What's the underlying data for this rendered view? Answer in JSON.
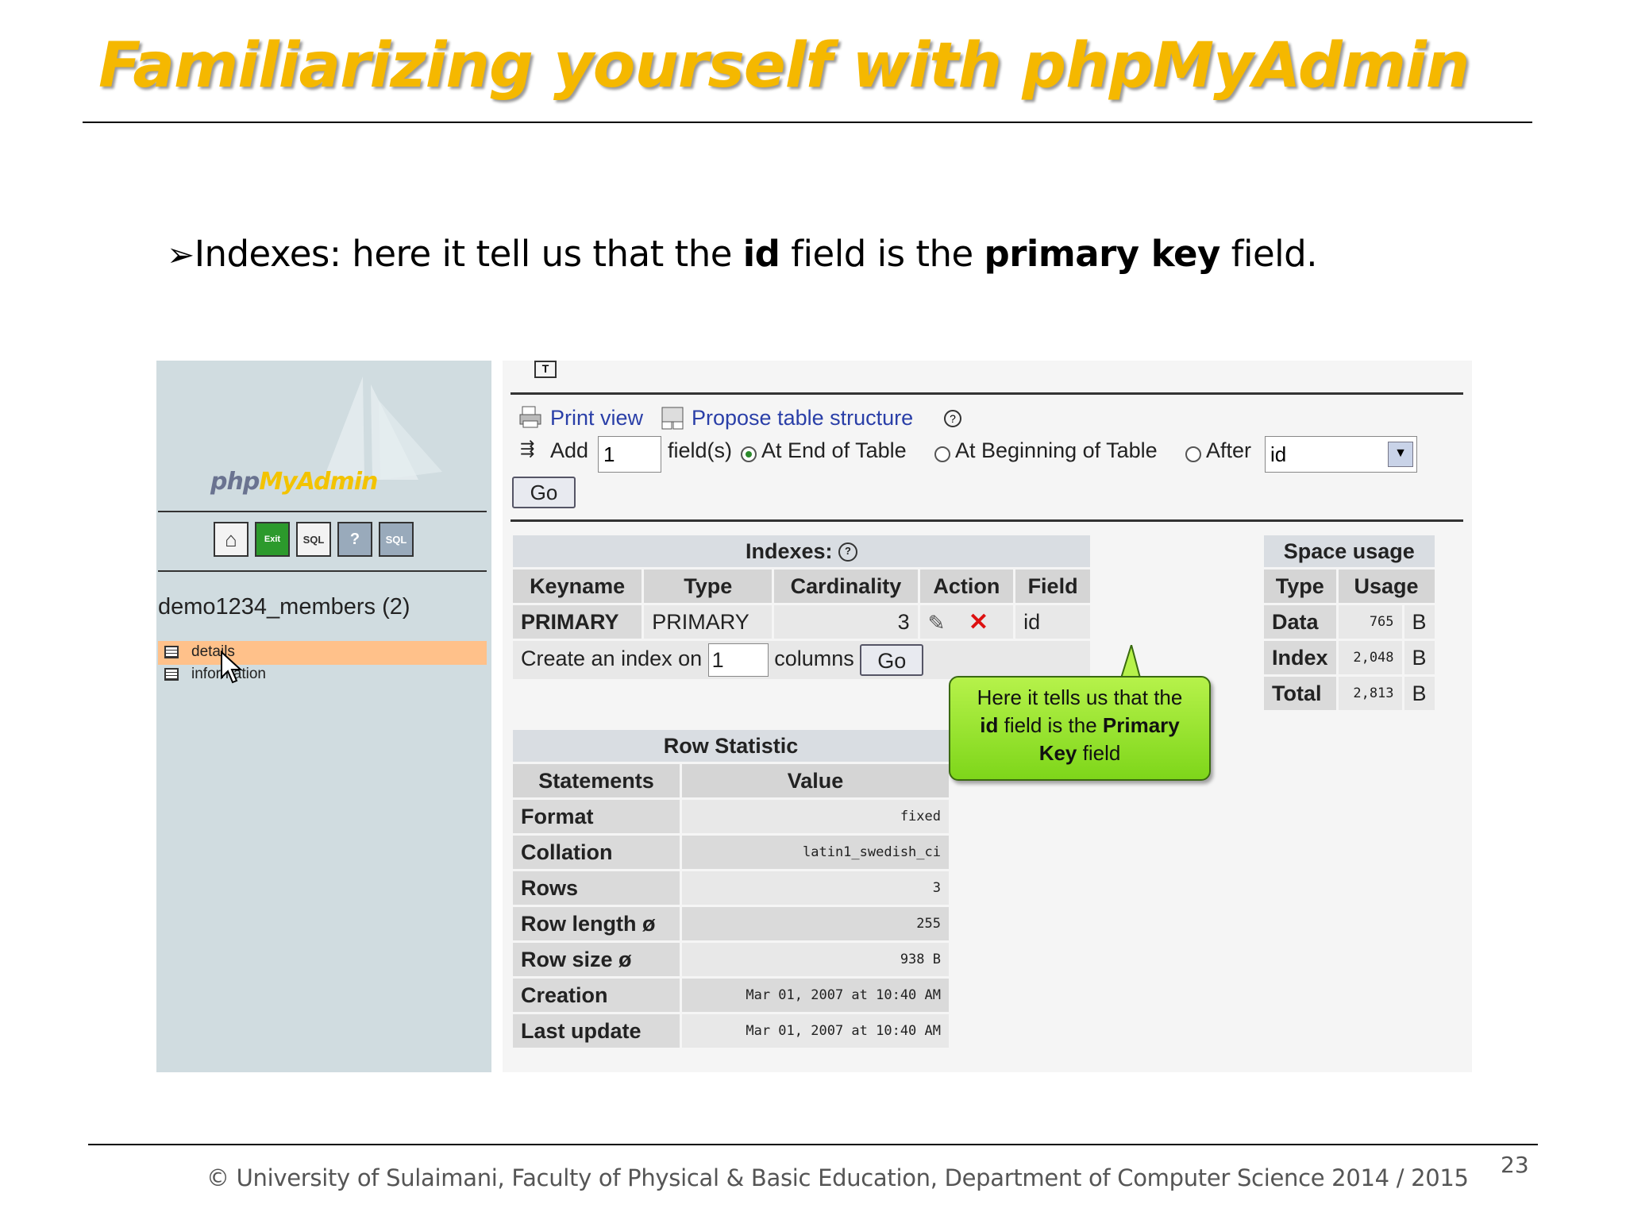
{
  "slide": {
    "title": "Familiarizing yourself with phpMyAdmin",
    "bullet": {
      "part1": "Indexes: here it tell us that the ",
      "bold1": "id",
      "part2": " field is the ",
      "bold2": "primary key",
      "part3": " field."
    },
    "footer": "© University of Sulaimani, Faculty of Physical & Basic Education, Department of Computer Science  2014 / 2015",
    "page_number": "23"
  },
  "left_pane": {
    "logo_part1": "php",
    "logo_part2": "MyAdmin",
    "icons": [
      {
        "name": "home-icon",
        "glyph": "⌂"
      },
      {
        "name": "exit-icon",
        "glyph": "Exit"
      },
      {
        "name": "sql-icon",
        "glyph": "SQL"
      },
      {
        "name": "help-icon",
        "glyph": "?"
      },
      {
        "name": "sql-docs-icon",
        "glyph": "SQL"
      }
    ],
    "database": "demo1234_members (2)",
    "tables": [
      "details",
      "information"
    ]
  },
  "toolbar": {
    "print_view": "Print view",
    "propose_structure": "Propose table structure",
    "add_label": "Add",
    "add_value": "1",
    "fields_label": "field(s)",
    "at_end": "At End of Table",
    "at_beginning": "At Beginning of Table",
    "after": "After",
    "after_value": "id",
    "go": "Go"
  },
  "indexes": {
    "caption": "Indexes:",
    "headers": [
      "Keyname",
      "Type",
      "Cardinality",
      "Action",
      "Field"
    ],
    "row": {
      "keyname": "PRIMARY",
      "type": "PRIMARY",
      "cardinality": "3",
      "field": "id"
    },
    "create_label": "Create an index on",
    "create_value": "1",
    "columns_label": "columns",
    "go": "Go"
  },
  "space_usage": {
    "caption": "Space usage",
    "headers": [
      "Type",
      "Usage"
    ],
    "rows": [
      {
        "type": "Data",
        "usage": "765",
        "unit": "B"
      },
      {
        "type": "Index",
        "usage": "2,048",
        "unit": "B"
      },
      {
        "type": "Total",
        "usage": "2,813",
        "unit": "B"
      }
    ]
  },
  "row_statistics": {
    "caption": "Row Statistic",
    "headers": [
      "Statements",
      "Value"
    ],
    "rows": [
      {
        "label": "Format",
        "value": "fixed"
      },
      {
        "label": "Collation",
        "value": "latin1_swedish_ci"
      },
      {
        "label": "Rows",
        "value": "3"
      },
      {
        "label": "Row length ø",
        "value": "255"
      },
      {
        "label": "Row size ø",
        "value": "938 B"
      },
      {
        "label": "Creation",
        "value": "Mar 01, 2007 at 10:40 AM"
      },
      {
        "label": "Last update",
        "value": "Mar 01, 2007 at 10:40 AM"
      }
    ]
  },
  "callout": {
    "line1": "Here it tells us that the",
    "bold_a": "id",
    "line2": " field is the ",
    "bold_b": "Primary",
    "bold_c": "Key",
    "line3": " field"
  },
  "colors": {
    "title": "#f5b800",
    "callout": "#8fe02a",
    "link": "#2a3fa8",
    "selected_row": "#ffc18a"
  }
}
